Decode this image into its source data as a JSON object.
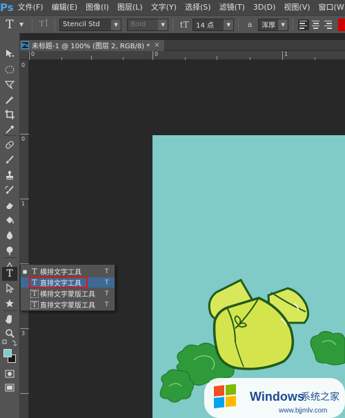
{
  "app": {
    "logo": "Ps"
  },
  "menu": {
    "items": [
      "文件(F)",
      "编辑(E)",
      "图像(I)",
      "图层(L)",
      "文字(Y)",
      "选择(S)",
      "滤镜(T)",
      "3D(D)",
      "视图(V)",
      "窗口(W)"
    ]
  },
  "options": {
    "tool_glyph": "T",
    "orientation_icon": "text-orientation-icon",
    "font_family": "Stencil Std",
    "font_style": "Bold",
    "size_glyph": "tT",
    "font_size": "14 点",
    "aa_glyph": "a",
    "antialias": "浑厚"
  },
  "document": {
    "tab_title": "未标题-1 @ 100% (图层 2, RGB/8) *",
    "close": "×"
  },
  "ruler": {
    "top_labels": [
      "0",
      "0",
      "1"
    ],
    "left_labels": [
      "0",
      "1",
      "2",
      "3"
    ]
  },
  "flyout": {
    "items": [
      {
        "bullet": "■",
        "icon": "T",
        "label": "横排文字工具",
        "key": "T"
      },
      {
        "bullet": "",
        "icon": "T",
        "label": "直排文字工具",
        "key": "T"
      },
      {
        "bullet": "",
        "icon": "T",
        "label": "横排文字蒙版工具",
        "key": "T"
      },
      {
        "bullet": "",
        "icon": "T",
        "label": "直排文字蒙版工具",
        "key": "T"
      }
    ]
  },
  "colors": {
    "foreground": "#7dcccc",
    "background": "#1a1a1a",
    "canvas": "#80cbc8",
    "highlight_box": "#e01414"
  },
  "watermark": {
    "brand": "Windows",
    "cn": "系统之家",
    "url": "www.bjjmlv.com"
  }
}
